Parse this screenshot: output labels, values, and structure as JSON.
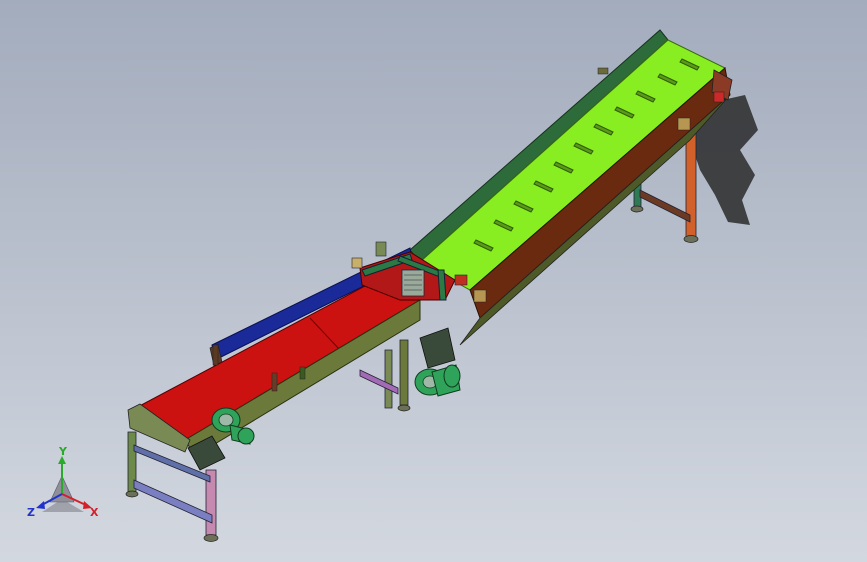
{
  "window": {
    "background_top": "#a3acbd",
    "background_bottom": "#d3d8e0"
  },
  "model": {
    "incline_belt_color": "#88ee22",
    "flat_belt_color": "#cc1111",
    "frame_color": "#6b7a3a",
    "side_guard_dark": "#2e6b3a",
    "side_guard_blue": "#1a2a99",
    "side_guard_brown": "#6a2a10",
    "motor_color": "#2fa35a",
    "leg_colors": [
      "#5f6fa8",
      "#c68ab0",
      "#d2602a",
      "#a36ab5"
    ]
  },
  "triad": {
    "x_label": "X",
    "y_label": "Y",
    "z_label": "Z",
    "x_color": "#d4202a",
    "y_color": "#2aaa2a",
    "z_color": "#2233cc"
  }
}
